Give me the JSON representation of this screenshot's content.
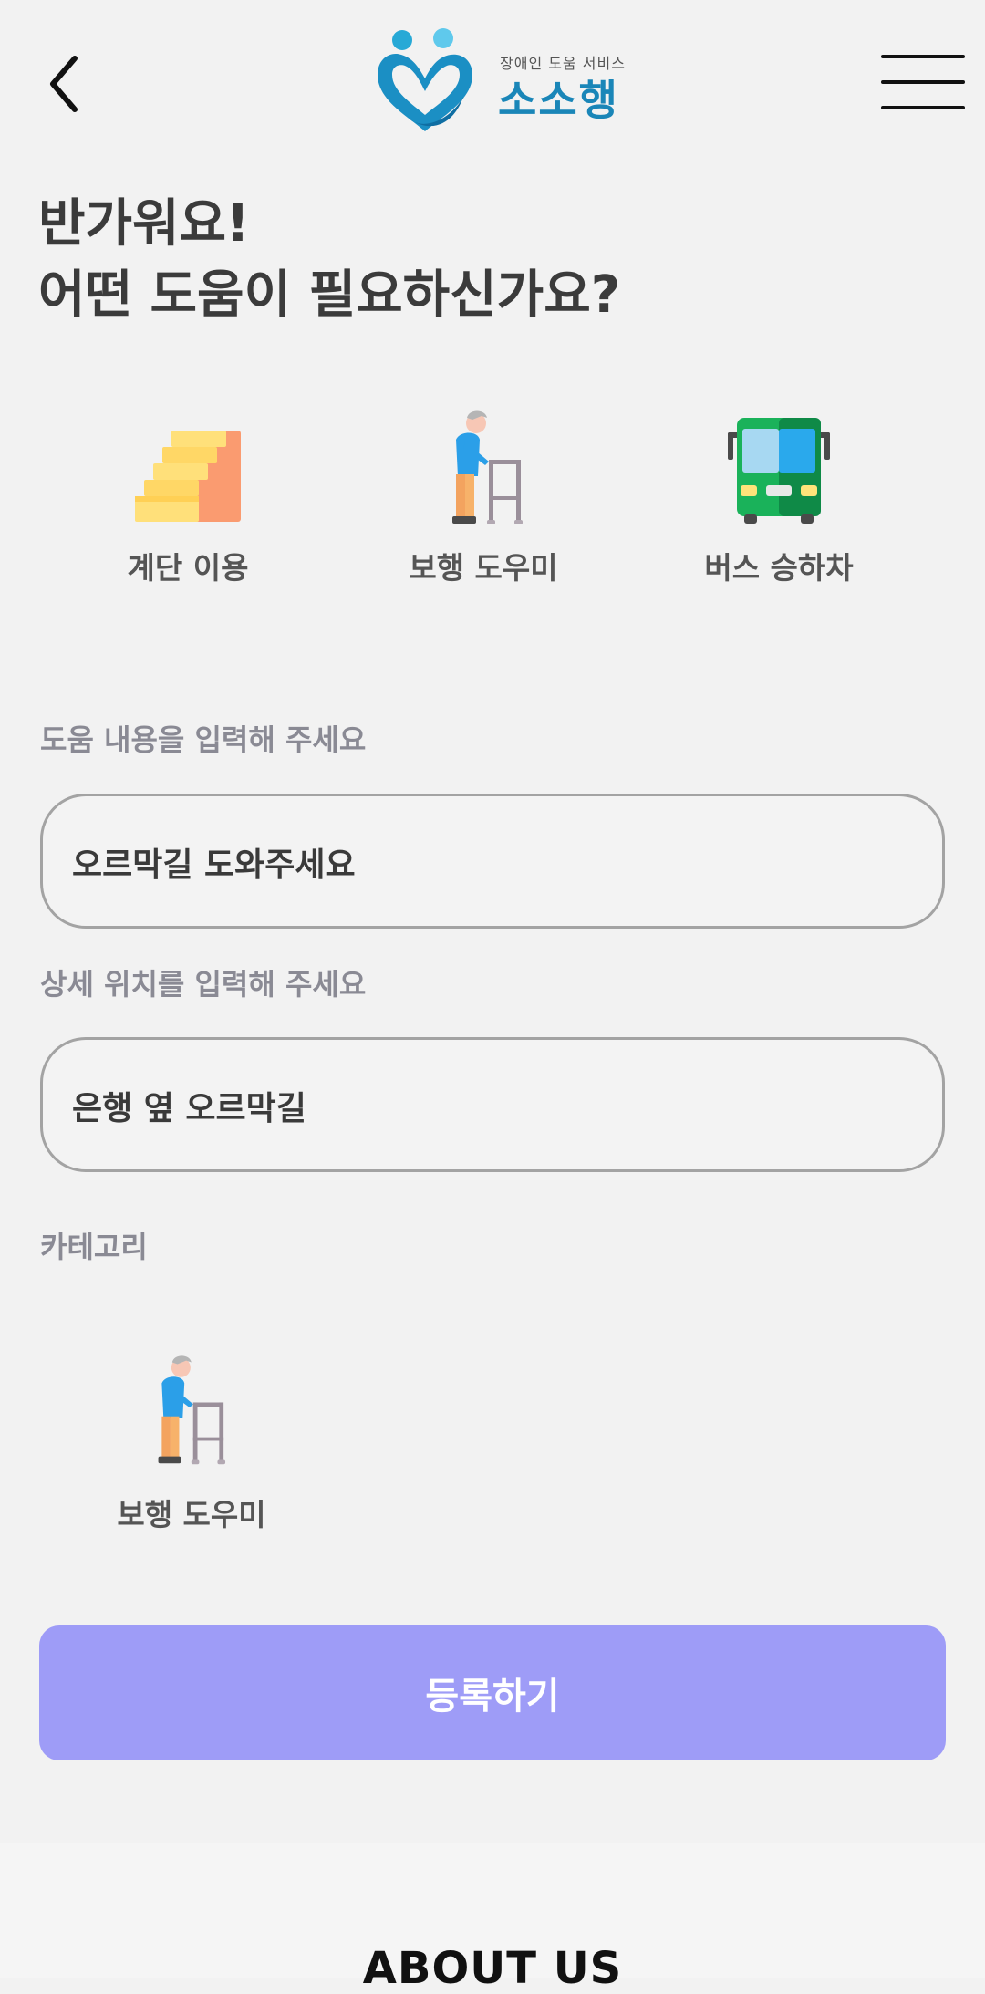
{
  "header": {
    "logo_subtitle": "장애인 도움 서비스",
    "logo_title": "소소행",
    "brand_color": "#1a86b8"
  },
  "greeting": {
    "line1": "반가워요!",
    "line2": "어떤 도움이 필요하신가요?"
  },
  "categories": [
    {
      "label": "계단 이용",
      "icon": "stairs-icon"
    },
    {
      "label": "보행 도우미",
      "icon": "elderly-walker-icon"
    },
    {
      "label": "버스 승하차",
      "icon": "bus-icon"
    }
  ],
  "form": {
    "help_label": "도움 내용을 입력해 주세요",
    "help_value": "오르막길 도와주세요",
    "location_label": "상세 위치를 입력해 주세요",
    "location_value": "은행 옆 오르막길",
    "category_label": "카테고리",
    "selected_category": "보행 도우미",
    "selected_icon": "elderly-walker-icon"
  },
  "submit": {
    "label": "등록하기",
    "color": "#9e9cf7"
  },
  "footer": {
    "about": "ABOUT US"
  }
}
